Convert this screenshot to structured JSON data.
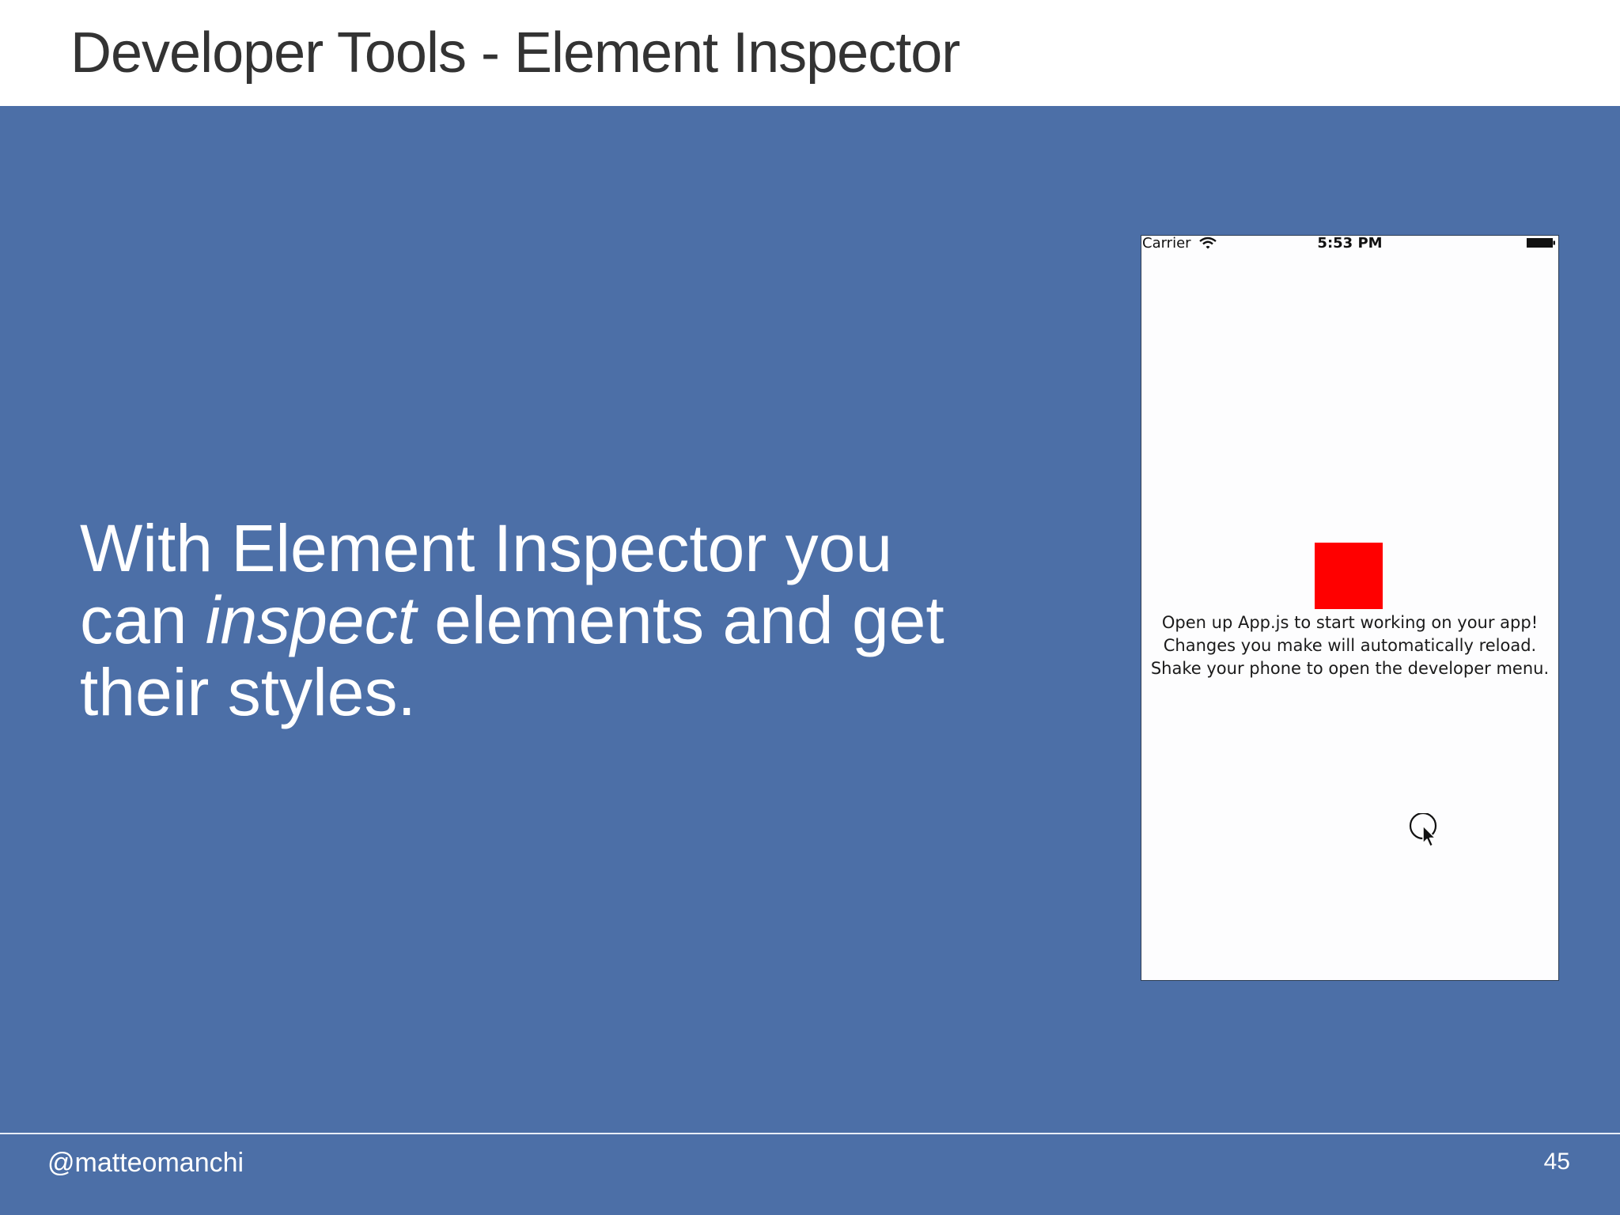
{
  "slide": {
    "title": "Developer Tools - Element Inspector",
    "body": {
      "line1": "With Element Inspector you",
      "line2_before": "can ",
      "line2_emphasis": "inspect",
      "line2_after": " elements and get",
      "line3": "their styles."
    },
    "footer": {
      "handle": "@matteomanchi",
      "page_number": "45"
    },
    "colors": {
      "background": "#4c6fa7",
      "header_background": "#ffffff",
      "title_text": "#333333",
      "body_text": "#ffffff"
    }
  },
  "phone": {
    "status_bar": {
      "carrier": "Carrier",
      "time": "5:53 PM",
      "wifi_icon": "wifi-icon",
      "battery_icon": "battery-icon"
    },
    "red_box_color": "#ff0000",
    "instructions": [
      "Open up App.js to start working on your app!",
      "Changes you make will automatically reload.",
      "Shake your phone to open the developer menu."
    ],
    "cursor_icon": "pointer-cursor-icon"
  }
}
